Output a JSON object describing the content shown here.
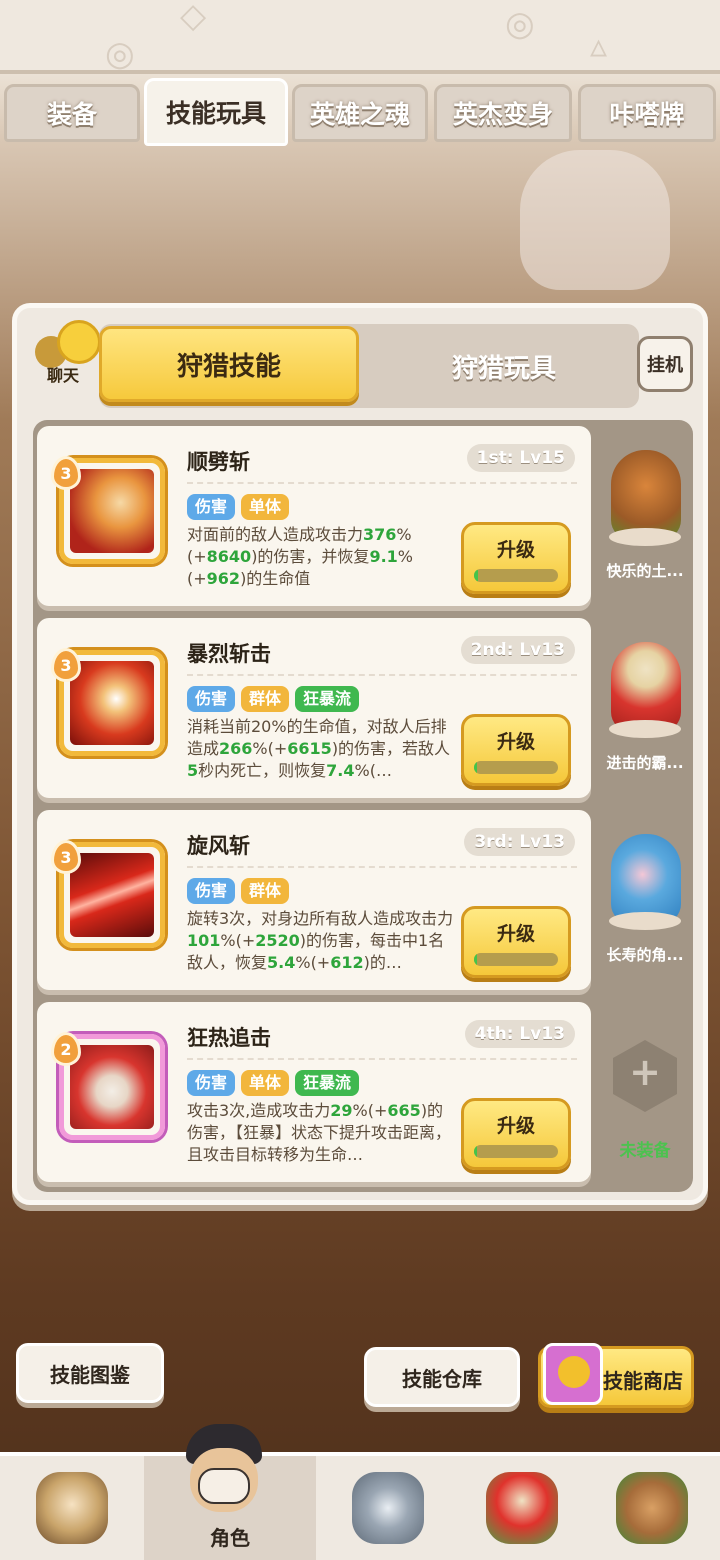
{
  "top_tabs": [
    {
      "label": "装备",
      "active": false
    },
    {
      "label": "技能玩具",
      "active": true
    },
    {
      "label": "英雄之魂",
      "active": false
    },
    {
      "label": "英杰变身",
      "active": false
    },
    {
      "label": "咔嗒牌",
      "active": false
    }
  ],
  "panel": {
    "chat_label": "聊天",
    "segment": {
      "left": "狩猎技能",
      "right": "狩猎玩具"
    },
    "idle_label": "挂机"
  },
  "skills": [
    {
      "name": "顺劈斩",
      "level": "3",
      "slot": "1st: Lv15",
      "tags": [
        "伤害",
        "单体"
      ],
      "desc": [
        {
          "t": "对面前的敌人造成攻击力",
          "g": false
        },
        {
          "t": "376",
          "g": true
        },
        {
          "t": "%(+",
          "g": false
        },
        {
          "t": "8640",
          "g": true
        },
        {
          "t": ")的伤害，并恢复",
          "g": false
        },
        {
          "t": "9.1",
          "g": true
        },
        {
          "t": "%(+",
          "g": false
        },
        {
          "t": "962",
          "g": true
        },
        {
          "t": ")的生命值",
          "g": false
        }
      ],
      "upgrade_label": "升级",
      "upgrade_progress": 0.05,
      "pet_name": "快乐的土..."
    },
    {
      "name": "暴烈斩击",
      "level": "3",
      "slot": "2nd: Lv13",
      "tags": [
        "伤害",
        "群体",
        "狂暴流"
      ],
      "desc": [
        {
          "t": "消耗当前20%的生命值，对敌人后排造成",
          "g": false
        },
        {
          "t": "266",
          "g": true
        },
        {
          "t": "%(+",
          "g": false
        },
        {
          "t": "6615",
          "g": true
        },
        {
          "t": ")的伤害，若敌人",
          "g": false
        },
        {
          "t": "5",
          "g": true
        },
        {
          "t": "秒内死亡，则恢复",
          "g": false
        },
        {
          "t": "7.4",
          "g": true
        },
        {
          "t": "%(",
          "g": false
        },
        {
          "t": "…",
          "g": false
        }
      ],
      "upgrade_label": "升级",
      "upgrade_progress": 0.03,
      "pet_name": "进击的霸..."
    },
    {
      "name": "旋风斩",
      "level": "3",
      "slot": "3rd: Lv13",
      "tags": [
        "伤害",
        "群体"
      ],
      "desc": [
        {
          "t": "旋转3次，对身边所有敌人造成攻击力",
          "g": false
        },
        {
          "t": "101",
          "g": true
        },
        {
          "t": "%(+",
          "g": false
        },
        {
          "t": "2520",
          "g": true
        },
        {
          "t": ")的伤害，每击中1名敌人，恢复",
          "g": false
        },
        {
          "t": "5.4",
          "g": true
        },
        {
          "t": "%(+",
          "g": false
        },
        {
          "t": "612",
          "g": true
        },
        {
          "t": ")的",
          "g": false
        },
        {
          "t": "…",
          "g": false
        }
      ],
      "upgrade_label": "升级",
      "upgrade_progress": 0.03,
      "pet_name": "长寿的角..."
    },
    {
      "name": "狂热追击",
      "level": "2",
      "slot": "4th: Lv13",
      "tags": [
        "伤害",
        "单体",
        "狂暴流"
      ],
      "desc": [
        {
          "t": "攻击3次,造成攻击力",
          "g": false
        },
        {
          "t": "29",
          "g": true
        },
        {
          "t": "%(+",
          "g": false
        },
        {
          "t": "665",
          "g": true
        },
        {
          "t": ")的伤害，【狂暴】状态下提升攻击距离，且攻击目标转移为生命",
          "g": false
        },
        {
          "t": "…",
          "g": false
        }
      ],
      "upgrade_label": "升级",
      "upgrade_progress": 0.03,
      "pet_name": "未装备"
    }
  ],
  "bottom_buttons": {
    "codex": "技能图鉴",
    "warehouse": "技能仓库",
    "shop": "技能商店"
  },
  "nav": {
    "active_label": "角色"
  },
  "colors": {
    "accent_yellow": "#f5c83a",
    "tag_blue": "#5ea9e8",
    "tag_gold": "#f2b63c",
    "tag_green": "#3fb84f",
    "highlight_green": "#2ea53b"
  }
}
